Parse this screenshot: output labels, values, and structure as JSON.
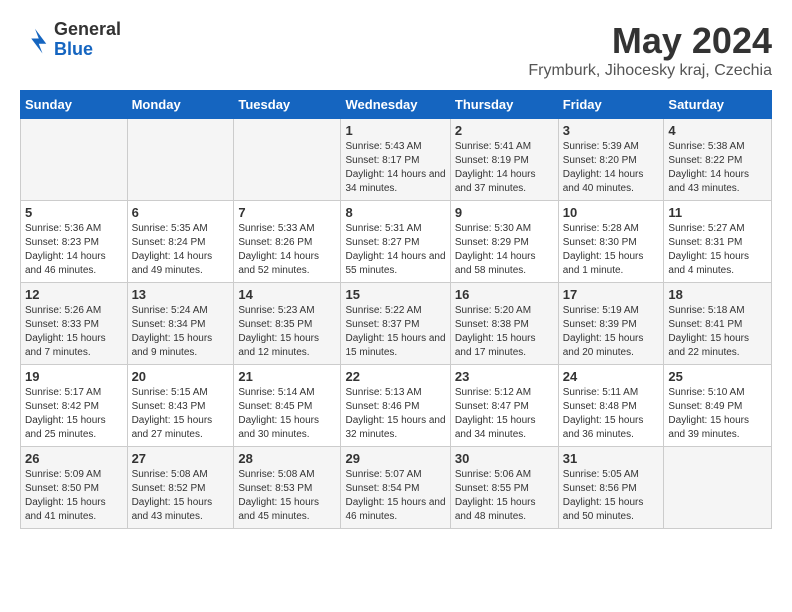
{
  "logo": {
    "general": "General",
    "blue": "Blue"
  },
  "header": {
    "month": "May 2024",
    "location": "Frymburk, Jihocesky kraj, Czechia"
  },
  "days_of_week": [
    "Sunday",
    "Monday",
    "Tuesday",
    "Wednesday",
    "Thursday",
    "Friday",
    "Saturday"
  ],
  "weeks": [
    [
      {
        "day": "",
        "info": ""
      },
      {
        "day": "",
        "info": ""
      },
      {
        "day": "",
        "info": ""
      },
      {
        "day": "1",
        "info": "Sunrise: 5:43 AM\nSunset: 8:17 PM\nDaylight: 14 hours and 34 minutes."
      },
      {
        "day": "2",
        "info": "Sunrise: 5:41 AM\nSunset: 8:19 PM\nDaylight: 14 hours and 37 minutes."
      },
      {
        "day": "3",
        "info": "Sunrise: 5:39 AM\nSunset: 8:20 PM\nDaylight: 14 hours and 40 minutes."
      },
      {
        "day": "4",
        "info": "Sunrise: 5:38 AM\nSunset: 8:22 PM\nDaylight: 14 hours and 43 minutes."
      }
    ],
    [
      {
        "day": "5",
        "info": "Sunrise: 5:36 AM\nSunset: 8:23 PM\nDaylight: 14 hours and 46 minutes."
      },
      {
        "day": "6",
        "info": "Sunrise: 5:35 AM\nSunset: 8:24 PM\nDaylight: 14 hours and 49 minutes."
      },
      {
        "day": "7",
        "info": "Sunrise: 5:33 AM\nSunset: 8:26 PM\nDaylight: 14 hours and 52 minutes."
      },
      {
        "day": "8",
        "info": "Sunrise: 5:31 AM\nSunset: 8:27 PM\nDaylight: 14 hours and 55 minutes."
      },
      {
        "day": "9",
        "info": "Sunrise: 5:30 AM\nSunset: 8:29 PM\nDaylight: 14 hours and 58 minutes."
      },
      {
        "day": "10",
        "info": "Sunrise: 5:28 AM\nSunset: 8:30 PM\nDaylight: 15 hours and 1 minute."
      },
      {
        "day": "11",
        "info": "Sunrise: 5:27 AM\nSunset: 8:31 PM\nDaylight: 15 hours and 4 minutes."
      }
    ],
    [
      {
        "day": "12",
        "info": "Sunrise: 5:26 AM\nSunset: 8:33 PM\nDaylight: 15 hours and 7 minutes."
      },
      {
        "day": "13",
        "info": "Sunrise: 5:24 AM\nSunset: 8:34 PM\nDaylight: 15 hours and 9 minutes."
      },
      {
        "day": "14",
        "info": "Sunrise: 5:23 AM\nSunset: 8:35 PM\nDaylight: 15 hours and 12 minutes."
      },
      {
        "day": "15",
        "info": "Sunrise: 5:22 AM\nSunset: 8:37 PM\nDaylight: 15 hours and 15 minutes."
      },
      {
        "day": "16",
        "info": "Sunrise: 5:20 AM\nSunset: 8:38 PM\nDaylight: 15 hours and 17 minutes."
      },
      {
        "day": "17",
        "info": "Sunrise: 5:19 AM\nSunset: 8:39 PM\nDaylight: 15 hours and 20 minutes."
      },
      {
        "day": "18",
        "info": "Sunrise: 5:18 AM\nSunset: 8:41 PM\nDaylight: 15 hours and 22 minutes."
      }
    ],
    [
      {
        "day": "19",
        "info": "Sunrise: 5:17 AM\nSunset: 8:42 PM\nDaylight: 15 hours and 25 minutes."
      },
      {
        "day": "20",
        "info": "Sunrise: 5:15 AM\nSunset: 8:43 PM\nDaylight: 15 hours and 27 minutes."
      },
      {
        "day": "21",
        "info": "Sunrise: 5:14 AM\nSunset: 8:45 PM\nDaylight: 15 hours and 30 minutes."
      },
      {
        "day": "22",
        "info": "Sunrise: 5:13 AM\nSunset: 8:46 PM\nDaylight: 15 hours and 32 minutes."
      },
      {
        "day": "23",
        "info": "Sunrise: 5:12 AM\nSunset: 8:47 PM\nDaylight: 15 hours and 34 minutes."
      },
      {
        "day": "24",
        "info": "Sunrise: 5:11 AM\nSunset: 8:48 PM\nDaylight: 15 hours and 36 minutes."
      },
      {
        "day": "25",
        "info": "Sunrise: 5:10 AM\nSunset: 8:49 PM\nDaylight: 15 hours and 39 minutes."
      }
    ],
    [
      {
        "day": "26",
        "info": "Sunrise: 5:09 AM\nSunset: 8:50 PM\nDaylight: 15 hours and 41 minutes."
      },
      {
        "day": "27",
        "info": "Sunrise: 5:08 AM\nSunset: 8:52 PM\nDaylight: 15 hours and 43 minutes."
      },
      {
        "day": "28",
        "info": "Sunrise: 5:08 AM\nSunset: 8:53 PM\nDaylight: 15 hours and 45 minutes."
      },
      {
        "day": "29",
        "info": "Sunrise: 5:07 AM\nSunset: 8:54 PM\nDaylight: 15 hours and 46 minutes."
      },
      {
        "day": "30",
        "info": "Sunrise: 5:06 AM\nSunset: 8:55 PM\nDaylight: 15 hours and 48 minutes."
      },
      {
        "day": "31",
        "info": "Sunrise: 5:05 AM\nSunset: 8:56 PM\nDaylight: 15 hours and 50 minutes."
      },
      {
        "day": "",
        "info": ""
      }
    ]
  ]
}
